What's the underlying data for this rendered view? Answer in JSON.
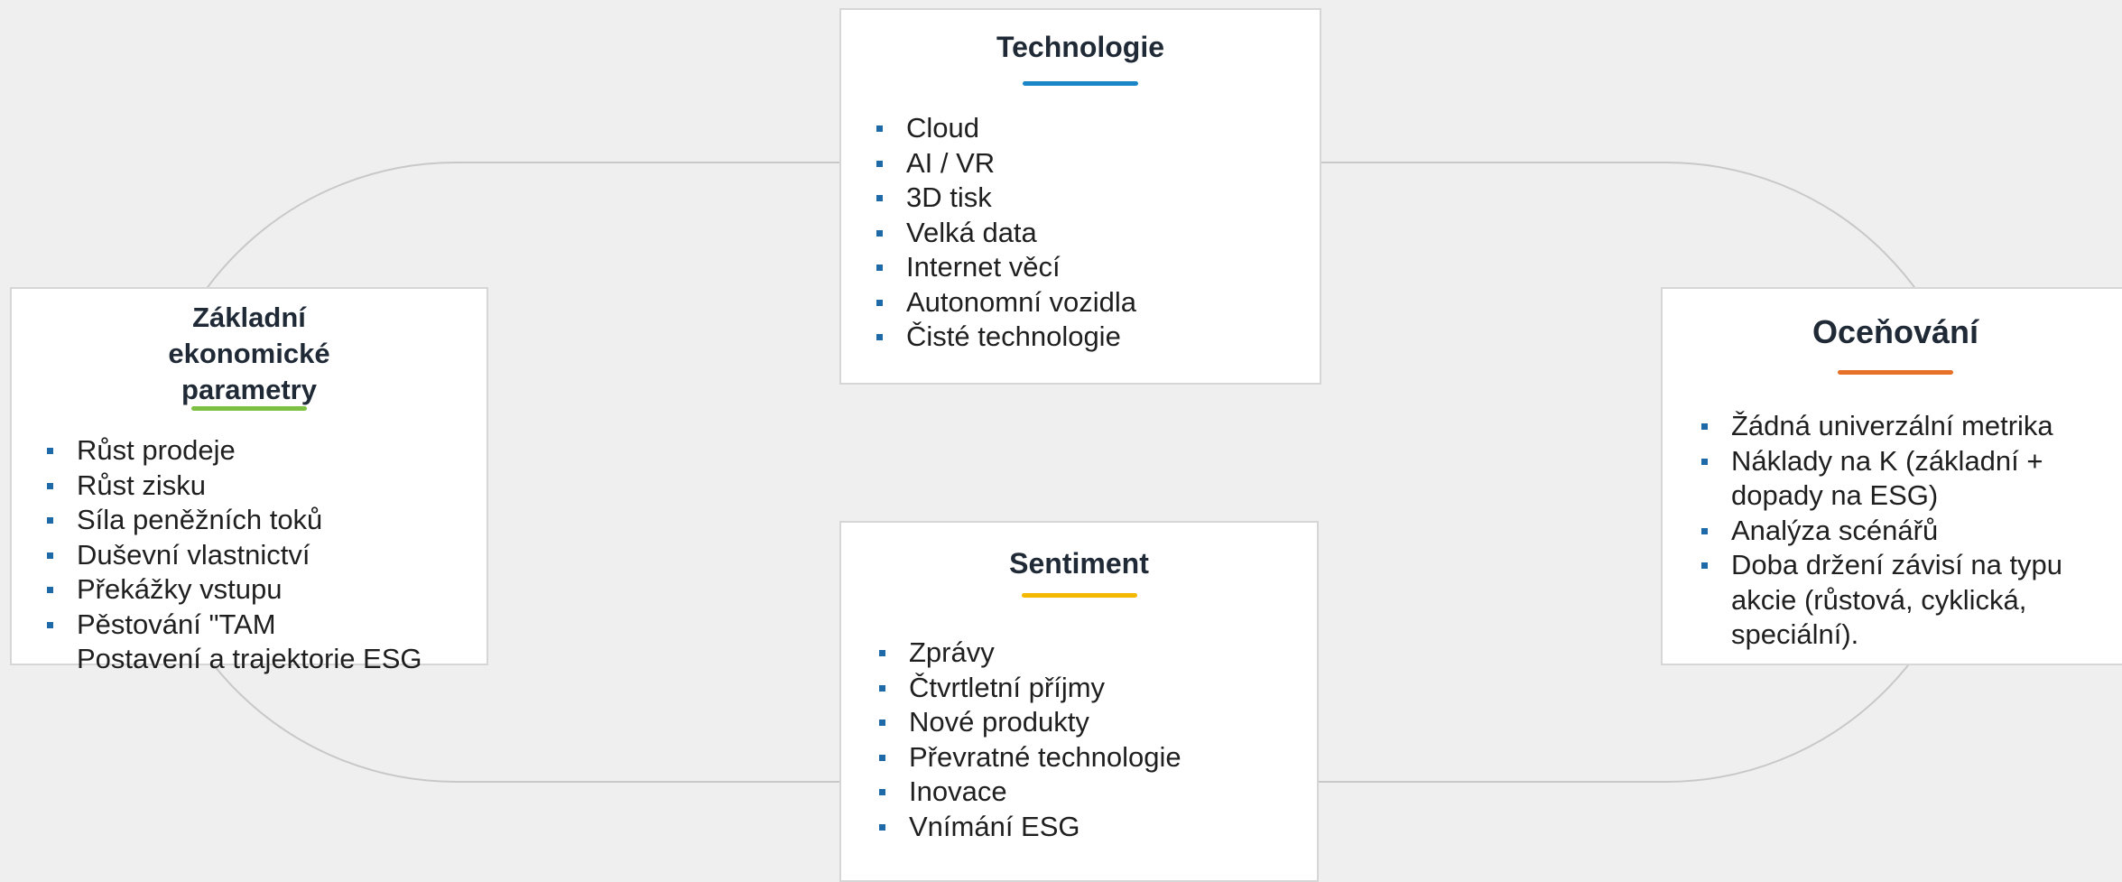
{
  "colors": {
    "background": "#efefef",
    "connector": "#c8c8c8",
    "bullet": "#1e6aa8"
  },
  "technology": {
    "title": "Technologie",
    "accent": "#1a86c8",
    "items": [
      "Cloud",
      "AI / VR",
      "3D tisk",
      "Velká data",
      "Internet věcí",
      "Autonomní vozidla",
      "Čisté technologie"
    ]
  },
  "fundamentals": {
    "title": "Základní ekonomické parametry",
    "accent": "#7cc142",
    "items": [
      "Růst prodeje",
      "Růst zisku",
      "Síla peněžních toků",
      "Duševní vlastnictví",
      "Překážky vstupu",
      "Pěstování \"TAM\nPostavení a trajektorie ESG"
    ]
  },
  "sentiment": {
    "title": "Sentiment",
    "accent": "#f5b800",
    "items": [
      "Zprávy",
      "Čtvrtletní příjmy",
      "Nové produkty",
      "Převratné technologie",
      "Inovace",
      "Vnímání ESG"
    ]
  },
  "valuation": {
    "title": "Oceňování",
    "accent": "#e8712a",
    "items": [
      "Žádná univerzální metrika",
      "Náklady na K (základní + dopady na ESG)",
      "Analýza scénářů",
      "Doba držení závisí na typu akcie (růstová, cyklická, speciální)."
    ]
  }
}
